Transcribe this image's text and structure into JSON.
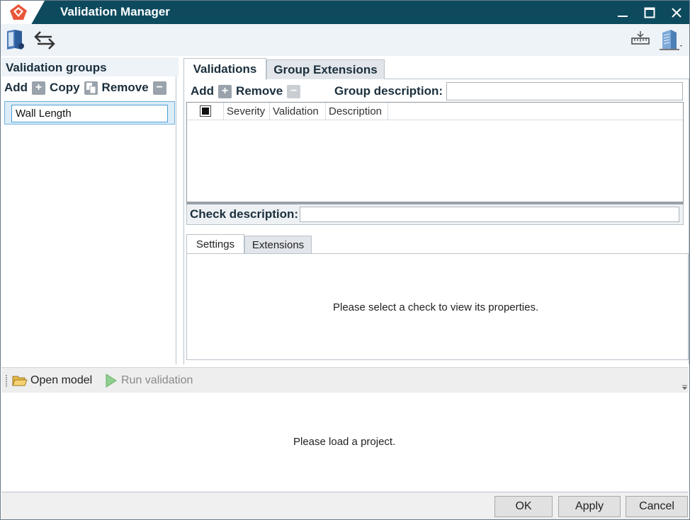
{
  "window": {
    "title": "Validation Manager"
  },
  "left_panel": {
    "title": "Validation groups",
    "actions": {
      "add": "Add",
      "copy": "Copy",
      "remove": "Remove"
    },
    "groups": [
      {
        "name": "Wall Length"
      }
    ]
  },
  "tabs": [
    {
      "label": "Validations"
    },
    {
      "label": "Group Extensions"
    }
  ],
  "validations": {
    "actions": {
      "add": "Add",
      "remove": "Remove"
    },
    "group_description_label": "Group description:",
    "group_description_value": "",
    "columns": [
      "Severity",
      "Validation",
      "Description"
    ],
    "check_description_label": "Check description:",
    "check_description_value": "",
    "subtabs": [
      {
        "label": "Settings"
      },
      {
        "label": "Extensions"
      }
    ],
    "empty_message": "Please select a check to view its properties."
  },
  "bottom_toolbar": {
    "open_model": "Open model",
    "run_validation": "Run validation"
  },
  "project_message": "Please load a project.",
  "footer": {
    "ok": "OK",
    "apply": "Apply",
    "cancel": "Cancel"
  },
  "icons": {
    "app_logo": "app-logo-icon",
    "toolbar_left": [
      "book-icon",
      "swap-arrows-icon"
    ],
    "toolbar_right": [
      "ruler-settings-icon",
      "building-icon"
    ]
  },
  "colors": {
    "titlebar": "#0d4a5e",
    "selection": "#dcecf8",
    "accent": "#e8563a"
  }
}
